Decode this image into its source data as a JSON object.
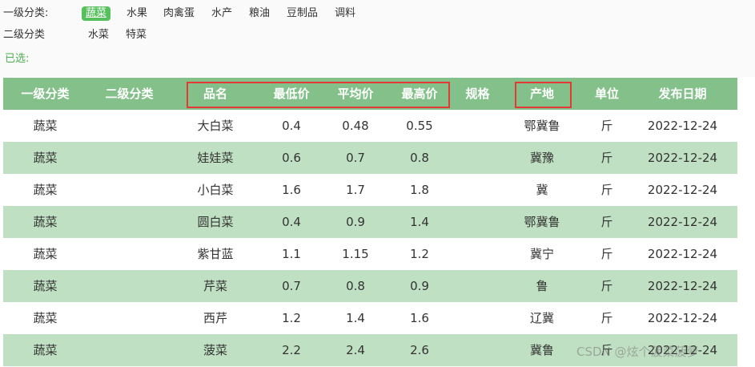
{
  "filters": {
    "level1_label": "一级分类:",
    "level1_items": [
      "蔬菜",
      "水果",
      "肉禽蛋",
      "水产",
      "粮油",
      "豆制品",
      "调料"
    ],
    "level1_active": "蔬菜",
    "level2_label": "二级分类",
    "level2_items": [
      "水菜",
      "特菜"
    ],
    "selected_label": "已选:"
  },
  "table": {
    "headers": [
      "一级分类",
      "二级分类",
      "品名",
      "最低价",
      "平均价",
      "最高价",
      "规格",
      "产地",
      "单位",
      "发布日期"
    ],
    "rows": [
      [
        "蔬菜",
        "",
        "大白菜",
        "0.4",
        "0.48",
        "0.55",
        "",
        "鄂冀鲁",
        "斤",
        "2022-12-24"
      ],
      [
        "蔬菜",
        "",
        "娃娃菜",
        "0.6",
        "0.7",
        "0.8",
        "",
        "冀豫",
        "斤",
        "2022-12-24"
      ],
      [
        "蔬菜",
        "",
        "小白菜",
        "1.6",
        "1.7",
        "1.8",
        "",
        "冀",
        "斤",
        "2022-12-24"
      ],
      [
        "蔬菜",
        "",
        "圆白菜",
        "0.4",
        "0.9",
        "1.4",
        "",
        "鄂冀鲁",
        "斤",
        "2022-12-24"
      ],
      [
        "蔬菜",
        "",
        "紫甘蓝",
        "1.1",
        "1.15",
        "1.2",
        "",
        "冀宁",
        "斤",
        "2022-12-24"
      ],
      [
        "蔬菜",
        "",
        "芹菜",
        "0.7",
        "0.8",
        "0.9",
        "",
        "鲁",
        "斤",
        "2022-12-24"
      ],
      [
        "蔬菜",
        "",
        "西芹",
        "1.2",
        "1.4",
        "1.6",
        "",
        "辽冀",
        "斤",
        "2022-12-24"
      ],
      [
        "蔬菜",
        "",
        "菠菜",
        "2.2",
        "2.4",
        "2.6",
        "",
        "冀鲁",
        "斤",
        "2022-12-24"
      ]
    ]
  },
  "watermark": "CSDN @炫个菠菜菠萝",
  "colors": {
    "header_bg": "#84c08a",
    "row_alt_bg": "#c0e0c3",
    "active_chip": "#55c05c",
    "highlight_box": "#e53935"
  }
}
